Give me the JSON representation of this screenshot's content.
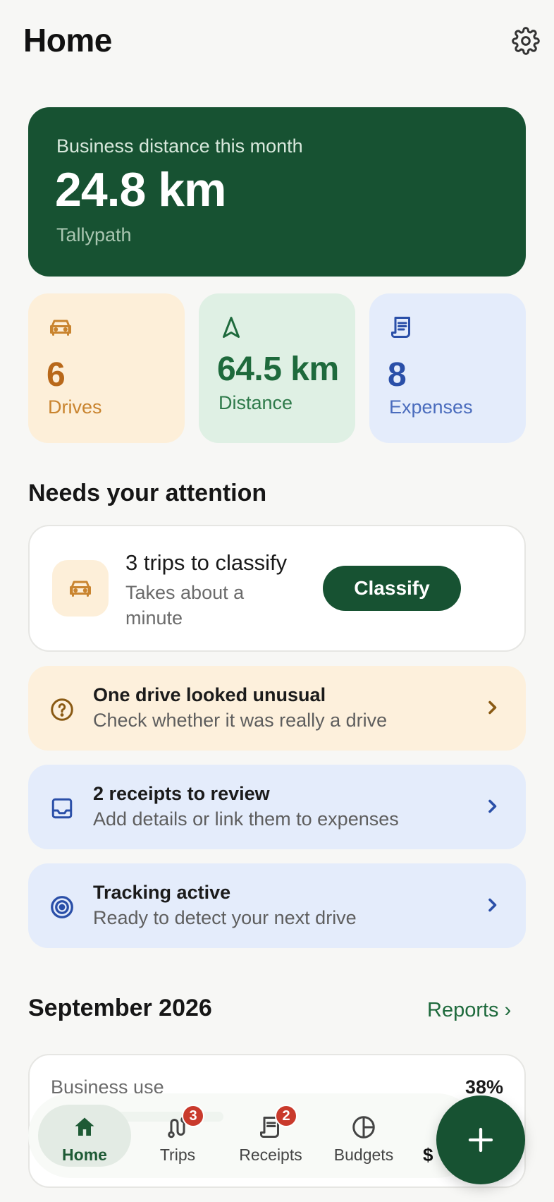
{
  "header": {
    "title": "Home"
  },
  "hero": {
    "label": "Business distance this month",
    "value": "24.8 km",
    "sub": "Tallypath"
  },
  "stats": [
    {
      "value": "6",
      "label": "Drives",
      "icon": "car-icon"
    },
    {
      "value": "64.5 km",
      "label": "Distance",
      "icon": "navigation-arrow-icon"
    },
    {
      "value": "8",
      "label": "Expenses",
      "icon": "receipt-icon"
    }
  ],
  "attention": {
    "title": "Needs your attention",
    "classify": {
      "title": "3 trips to classify",
      "sub": "Takes about a minute",
      "button": "Classify"
    },
    "items": [
      {
        "title": "One drive looked unusual",
        "sub": "Check whether it was really a drive",
        "icon": "question-circle-icon"
      },
      {
        "title": "2 receipts to review",
        "sub": "Add details or link them to expenses",
        "icon": "inbox-icon"
      },
      {
        "title": "Tracking active",
        "sub": "Ready to detect your next drive",
        "icon": "target-icon"
      }
    ]
  },
  "month": {
    "title": "September 2026",
    "reports_link": "Reports ›",
    "usage_label": "Business use",
    "usage_pct": "38%",
    "usage_fraction": 0.38
  },
  "nav": {
    "items": [
      {
        "label": "Home",
        "icon": "home-icon"
      },
      {
        "label": "Trips",
        "icon": "route-icon",
        "badge": "3"
      },
      {
        "label": "Receipts",
        "icon": "receipt-icon",
        "badge": "2"
      },
      {
        "label": "Budgets",
        "icon": "pie-chart-icon"
      },
      {
        "label": "$",
        "icon": "dollar-icon"
      }
    ]
  },
  "colors": {
    "brand_green": "#175232",
    "drives_bg": "#fdefd9",
    "distance_bg": "#dff0e4",
    "expenses_bg": "#e4ecfb",
    "badge_red": "#c93a2c"
  }
}
